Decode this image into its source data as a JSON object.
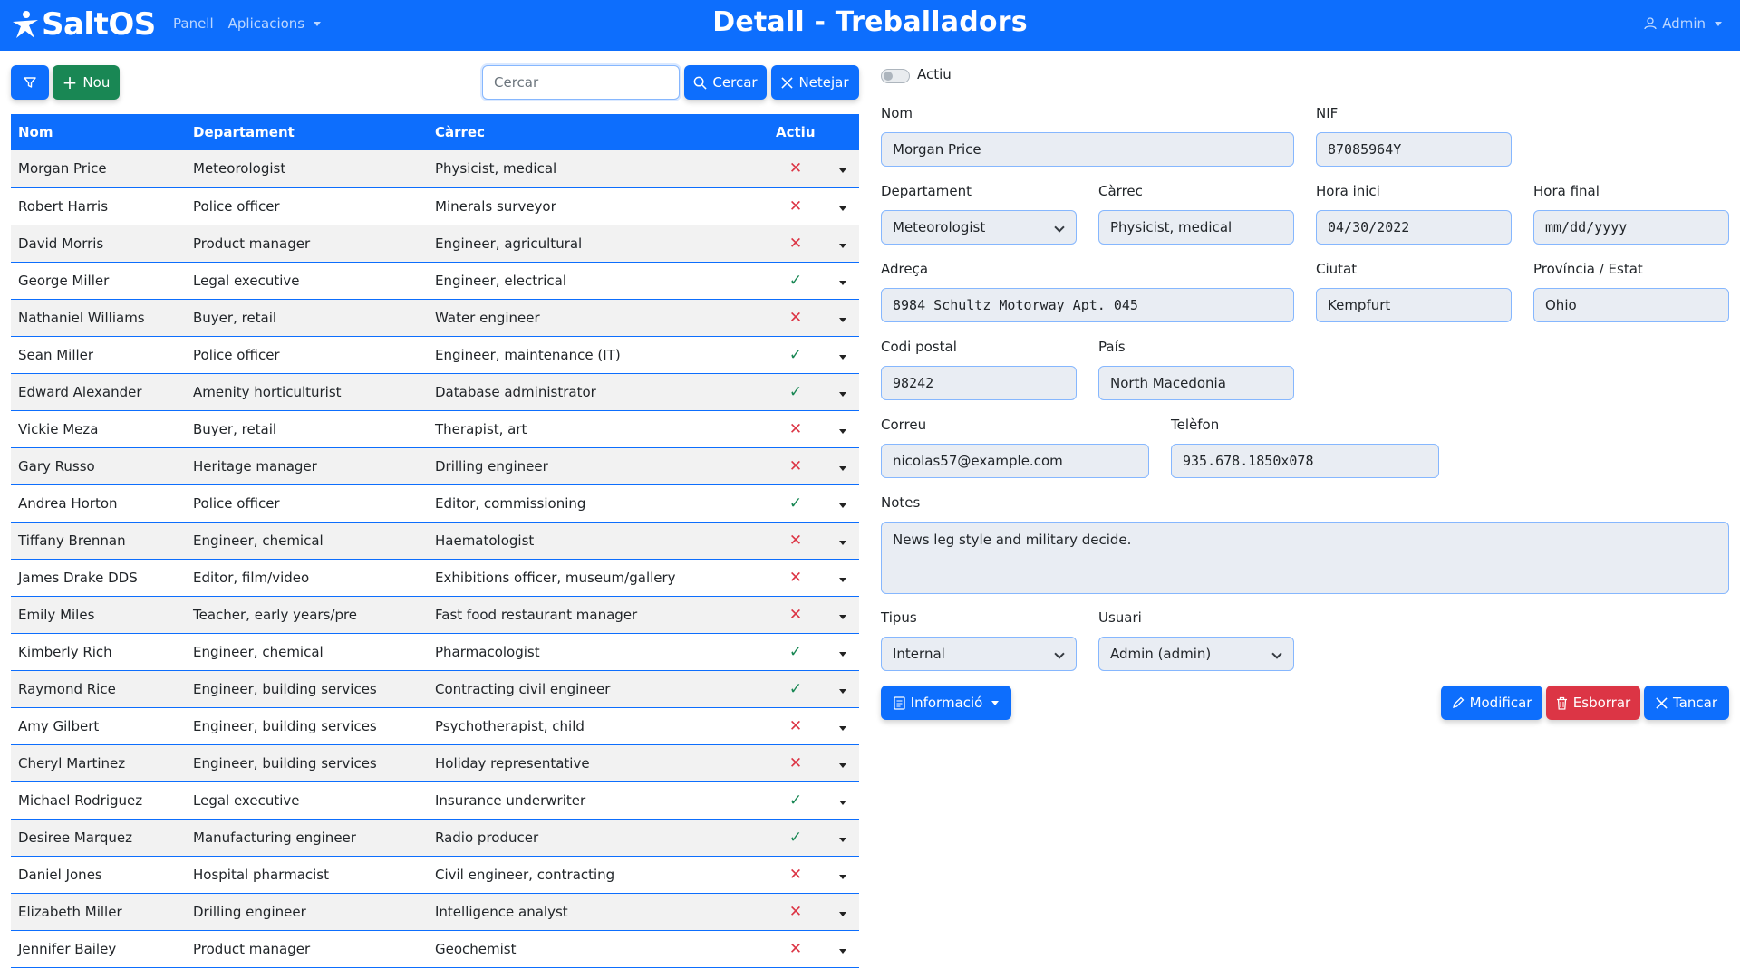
{
  "header": {
    "brand": "SaltOS",
    "nav": [
      {
        "label": "Panell"
      },
      {
        "label": "Aplicacions"
      }
    ],
    "title": "Detall - Treballadors",
    "user": "Admin"
  },
  "toolbar": {
    "new_label": "Nou",
    "search_placeholder": "Cercar",
    "search_label": "Cercar",
    "clear_label": "Netejar"
  },
  "table": {
    "columns": [
      "Nom",
      "Departament",
      "Càrrec",
      "Actiu"
    ],
    "rows": [
      {
        "name": "Morgan Price",
        "dept": "Meteorologist",
        "role": "Physicist, medical",
        "active": false
      },
      {
        "name": "Robert Harris",
        "dept": "Police officer",
        "role": "Minerals surveyor",
        "active": false
      },
      {
        "name": "David Morris",
        "dept": "Product manager",
        "role": "Engineer, agricultural",
        "active": false
      },
      {
        "name": "George Miller",
        "dept": "Legal executive",
        "role": "Engineer, electrical",
        "active": true
      },
      {
        "name": "Nathaniel Williams",
        "dept": "Buyer, retail",
        "role": "Water engineer",
        "active": false
      },
      {
        "name": "Sean Miller",
        "dept": "Police officer",
        "role": "Engineer, maintenance (IT)",
        "active": true
      },
      {
        "name": "Edward Alexander",
        "dept": "Amenity horticulturist",
        "role": "Database administrator",
        "active": true
      },
      {
        "name": "Vickie Meza",
        "dept": "Buyer, retail",
        "role": "Therapist, art",
        "active": false
      },
      {
        "name": "Gary Russo",
        "dept": "Heritage manager",
        "role": "Drilling engineer",
        "active": false
      },
      {
        "name": "Andrea Horton",
        "dept": "Police officer",
        "role": "Editor, commissioning",
        "active": true
      },
      {
        "name": "Tiffany Brennan",
        "dept": "Engineer, chemical",
        "role": "Haematologist",
        "active": false
      },
      {
        "name": "James Drake DDS",
        "dept": "Editor, film/video",
        "role": "Exhibitions officer, museum/gallery",
        "active": false
      },
      {
        "name": "Emily Miles",
        "dept": "Teacher, early years/pre",
        "role": "Fast food restaurant manager",
        "active": false
      },
      {
        "name": "Kimberly Rich",
        "dept": "Engineer, chemical",
        "role": "Pharmacologist",
        "active": true
      },
      {
        "name": "Raymond Rice",
        "dept": "Engineer, building services",
        "role": "Contracting civil engineer",
        "active": true
      },
      {
        "name": "Amy Gilbert",
        "dept": "Engineer, building services",
        "role": "Psychotherapist, child",
        "active": false
      },
      {
        "name": "Cheryl Martinez",
        "dept": "Engineer, building services",
        "role": "Holiday representative",
        "active": false
      },
      {
        "name": "Michael Rodriguez",
        "dept": "Legal executive",
        "role": "Insurance underwriter",
        "active": true
      },
      {
        "name": "Desiree Marquez",
        "dept": "Manufacturing engineer",
        "role": "Radio producer",
        "active": true
      },
      {
        "name": "Daniel Jones",
        "dept": "Hospital pharmacist",
        "role": "Civil engineer, contracting",
        "active": false
      },
      {
        "name": "Elizabeth Miller",
        "dept": "Drilling engineer",
        "role": "Intelligence analyst",
        "active": false
      },
      {
        "name": "Jennifer Bailey",
        "dept": "Product manager",
        "role": "Geochemist",
        "active": false
      }
    ]
  },
  "form": {
    "active_label": "Actiu",
    "labels": {
      "name": "Nom",
      "nif": "NIF",
      "dept": "Departament",
      "role": "Càrrec",
      "start": "Hora inici",
      "end": "Hora final",
      "address": "Adreça",
      "city": "Ciutat",
      "province": "Província / Estat",
      "zip": "Codi postal",
      "country": "País",
      "email": "Correu",
      "phone": "Telèfon",
      "notes": "Notes",
      "type": "Tipus",
      "user": "Usuari"
    },
    "values": {
      "name": "Morgan Price",
      "nif": "87085964Y",
      "dept": "Meteorologist",
      "role": "Physicist, medical",
      "start": "04/30/2022",
      "end": "mm/dd/yyyy",
      "address": "8984 Schultz Motorway Apt. 045",
      "city": "Kempfurt",
      "province": "Ohio",
      "zip": "98242",
      "country": "North Macedonia",
      "email": "nicolas57@example.com",
      "phone": "935.678.1850x078",
      "notes": "News leg style and military decide.",
      "type": "Internal",
      "user": "Admin (admin)"
    },
    "buttons": {
      "info": "Informació",
      "modify": "Modificar",
      "delete": "Esborrar",
      "close": "Tancar"
    }
  },
  "colors": {
    "primary": "#0d6efd",
    "success": "#198754",
    "danger": "#dc3545"
  }
}
